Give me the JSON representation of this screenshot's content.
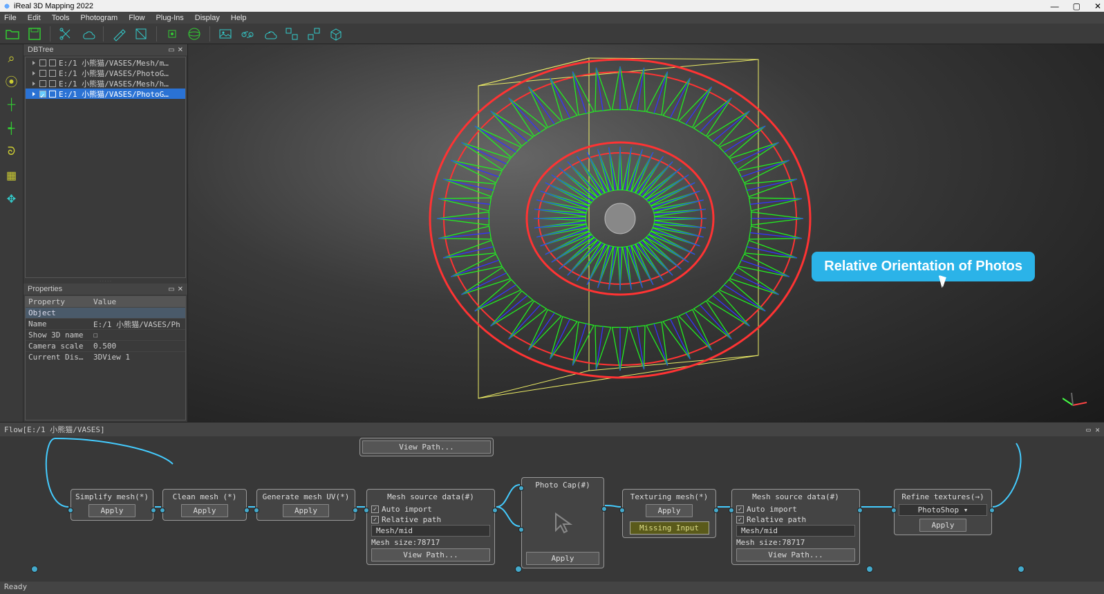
{
  "app": {
    "title": "iReal 3D Mapping 2022",
    "window": {
      "min": "—",
      "max": "▢",
      "close": "✕"
    }
  },
  "menu": [
    "File",
    "Edit",
    "Tools",
    "Photogram",
    "Flow",
    "Plug-Ins",
    "Display",
    "Help"
  ],
  "left_tools": [
    {
      "name": "zoom-icon",
      "glyph": "⌕"
    },
    {
      "name": "zoom-all-icon",
      "glyph": "⦿"
    },
    {
      "name": "axis-x-icon",
      "glyph": "┼"
    },
    {
      "name": "axis-y-icon",
      "glyph": "┽"
    },
    {
      "name": "graph-icon",
      "glyph": "ᘐ"
    },
    {
      "name": "grid-icon",
      "glyph": "▦"
    },
    {
      "name": "move-icon",
      "glyph": "✥"
    }
  ],
  "dbtree": {
    "title": "DBTree",
    "items": [
      {
        "label": "E:/1 小熊猫/VASES/Mesh/m…",
        "checked": false,
        "type": "box",
        "selected": false
      },
      {
        "label": "E:/1 小熊猫/VASES/PhotoG…",
        "checked": false,
        "type": "folder",
        "selected": false
      },
      {
        "label": "E:/1 小熊猫/VASES/Mesh/h…",
        "checked": false,
        "type": "box",
        "selected": false
      },
      {
        "label": "E:/1 小熊猫/VASES/PhotoG…",
        "checked": true,
        "type": "folder",
        "selected": true
      }
    ]
  },
  "properties": {
    "title": "Properties",
    "head": {
      "c1": "Property",
      "c2": "Value"
    },
    "section": "Object",
    "rows": [
      {
        "k": "Name",
        "v": "E:/1 小熊猫/VASES/Ph"
      },
      {
        "k": "Show 3D name",
        "v": "☐"
      },
      {
        "k": "Camera scale",
        "v": "0.500"
      },
      {
        "k": "Current Dis…",
        "v": "3DView 1"
      }
    ]
  },
  "callout": "Relative Orientation of Photos",
  "flow": {
    "title": "Flow[E:/1 小熊猫/VASES]",
    "view_path": "View Path...",
    "apply": "Apply",
    "auto_import": "Auto import",
    "relative_path": "Relative path",
    "mesh_mid": "Mesh/mid",
    "mesh_size": "Mesh size:78717",
    "missing": "Missing Input",
    "photoshop": "PhotoShop ▾",
    "nodes": {
      "simplify": "Simplify mesh(*)",
      "clean": "Clean mesh (*)",
      "genuv": "Generate mesh UV(*)",
      "src1": "Mesh source data(#)",
      "photo": "Photo Cap(#)",
      "tex": "Texturing mesh(*)",
      "src2": "Mesh source data(#)",
      "refine": "Refine textures(→)"
    }
  },
  "status": "Ready"
}
